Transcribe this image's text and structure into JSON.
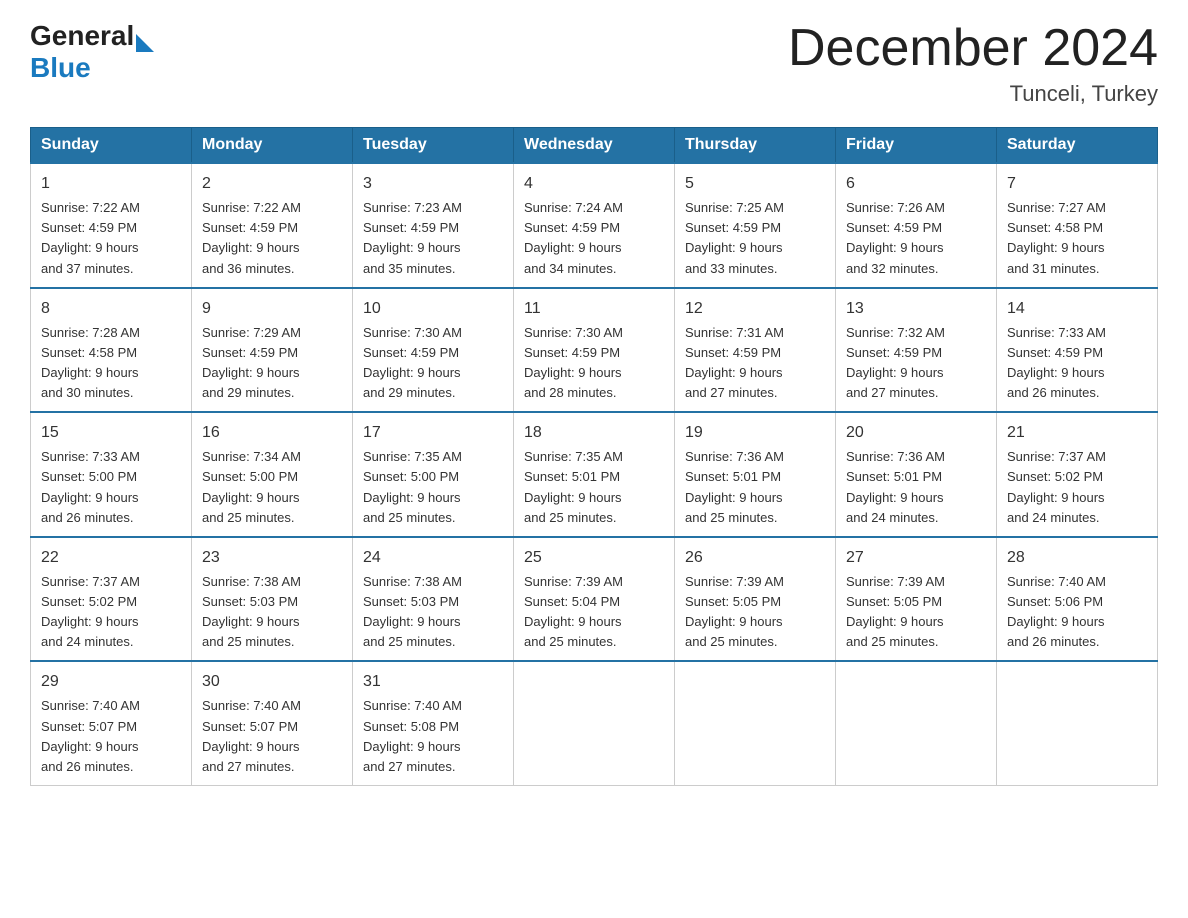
{
  "logo": {
    "general": "General",
    "blue": "Blue"
  },
  "header": {
    "month_year": "December 2024",
    "location": "Tunceli, Turkey"
  },
  "days_of_week": [
    "Sunday",
    "Monday",
    "Tuesday",
    "Wednesday",
    "Thursday",
    "Friday",
    "Saturday"
  ],
  "weeks": [
    [
      {
        "day": "1",
        "sunrise": "7:22 AM",
        "sunset": "4:59 PM",
        "daylight": "9 hours and 37 minutes."
      },
      {
        "day": "2",
        "sunrise": "7:22 AM",
        "sunset": "4:59 PM",
        "daylight": "9 hours and 36 minutes."
      },
      {
        "day": "3",
        "sunrise": "7:23 AM",
        "sunset": "4:59 PM",
        "daylight": "9 hours and 35 minutes."
      },
      {
        "day": "4",
        "sunrise": "7:24 AM",
        "sunset": "4:59 PM",
        "daylight": "9 hours and 34 minutes."
      },
      {
        "day": "5",
        "sunrise": "7:25 AM",
        "sunset": "4:59 PM",
        "daylight": "9 hours and 33 minutes."
      },
      {
        "day": "6",
        "sunrise": "7:26 AM",
        "sunset": "4:59 PM",
        "daylight": "9 hours and 32 minutes."
      },
      {
        "day": "7",
        "sunrise": "7:27 AM",
        "sunset": "4:58 PM",
        "daylight": "9 hours and 31 minutes."
      }
    ],
    [
      {
        "day": "8",
        "sunrise": "7:28 AM",
        "sunset": "4:58 PM",
        "daylight": "9 hours and 30 minutes."
      },
      {
        "day": "9",
        "sunrise": "7:29 AM",
        "sunset": "4:59 PM",
        "daylight": "9 hours and 29 minutes."
      },
      {
        "day": "10",
        "sunrise": "7:30 AM",
        "sunset": "4:59 PM",
        "daylight": "9 hours and 29 minutes."
      },
      {
        "day": "11",
        "sunrise": "7:30 AM",
        "sunset": "4:59 PM",
        "daylight": "9 hours and 28 minutes."
      },
      {
        "day": "12",
        "sunrise": "7:31 AM",
        "sunset": "4:59 PM",
        "daylight": "9 hours and 27 minutes."
      },
      {
        "day": "13",
        "sunrise": "7:32 AM",
        "sunset": "4:59 PM",
        "daylight": "9 hours and 27 minutes."
      },
      {
        "day": "14",
        "sunrise": "7:33 AM",
        "sunset": "4:59 PM",
        "daylight": "9 hours and 26 minutes."
      }
    ],
    [
      {
        "day": "15",
        "sunrise": "7:33 AM",
        "sunset": "5:00 PM",
        "daylight": "9 hours and 26 minutes."
      },
      {
        "day": "16",
        "sunrise": "7:34 AM",
        "sunset": "5:00 PM",
        "daylight": "9 hours and 25 minutes."
      },
      {
        "day": "17",
        "sunrise": "7:35 AM",
        "sunset": "5:00 PM",
        "daylight": "9 hours and 25 minutes."
      },
      {
        "day": "18",
        "sunrise": "7:35 AM",
        "sunset": "5:01 PM",
        "daylight": "9 hours and 25 minutes."
      },
      {
        "day": "19",
        "sunrise": "7:36 AM",
        "sunset": "5:01 PM",
        "daylight": "9 hours and 25 minutes."
      },
      {
        "day": "20",
        "sunrise": "7:36 AM",
        "sunset": "5:01 PM",
        "daylight": "9 hours and 24 minutes."
      },
      {
        "day": "21",
        "sunrise": "7:37 AM",
        "sunset": "5:02 PM",
        "daylight": "9 hours and 24 minutes."
      }
    ],
    [
      {
        "day": "22",
        "sunrise": "7:37 AM",
        "sunset": "5:02 PM",
        "daylight": "9 hours and 24 minutes."
      },
      {
        "day": "23",
        "sunrise": "7:38 AM",
        "sunset": "5:03 PM",
        "daylight": "9 hours and 25 minutes."
      },
      {
        "day": "24",
        "sunrise": "7:38 AM",
        "sunset": "5:03 PM",
        "daylight": "9 hours and 25 minutes."
      },
      {
        "day": "25",
        "sunrise": "7:39 AM",
        "sunset": "5:04 PM",
        "daylight": "9 hours and 25 minutes."
      },
      {
        "day": "26",
        "sunrise": "7:39 AM",
        "sunset": "5:05 PM",
        "daylight": "9 hours and 25 minutes."
      },
      {
        "day": "27",
        "sunrise": "7:39 AM",
        "sunset": "5:05 PM",
        "daylight": "9 hours and 25 minutes."
      },
      {
        "day": "28",
        "sunrise": "7:40 AM",
        "sunset": "5:06 PM",
        "daylight": "9 hours and 26 minutes."
      }
    ],
    [
      {
        "day": "29",
        "sunrise": "7:40 AM",
        "sunset": "5:07 PM",
        "daylight": "9 hours and 26 minutes."
      },
      {
        "day": "30",
        "sunrise": "7:40 AM",
        "sunset": "5:07 PM",
        "daylight": "9 hours and 27 minutes."
      },
      {
        "day": "31",
        "sunrise": "7:40 AM",
        "sunset": "5:08 PM",
        "daylight": "9 hours and 27 minutes."
      },
      null,
      null,
      null,
      null
    ]
  ],
  "labels": {
    "sunrise": "Sunrise:",
    "sunset": "Sunset:",
    "daylight": "Daylight:"
  }
}
